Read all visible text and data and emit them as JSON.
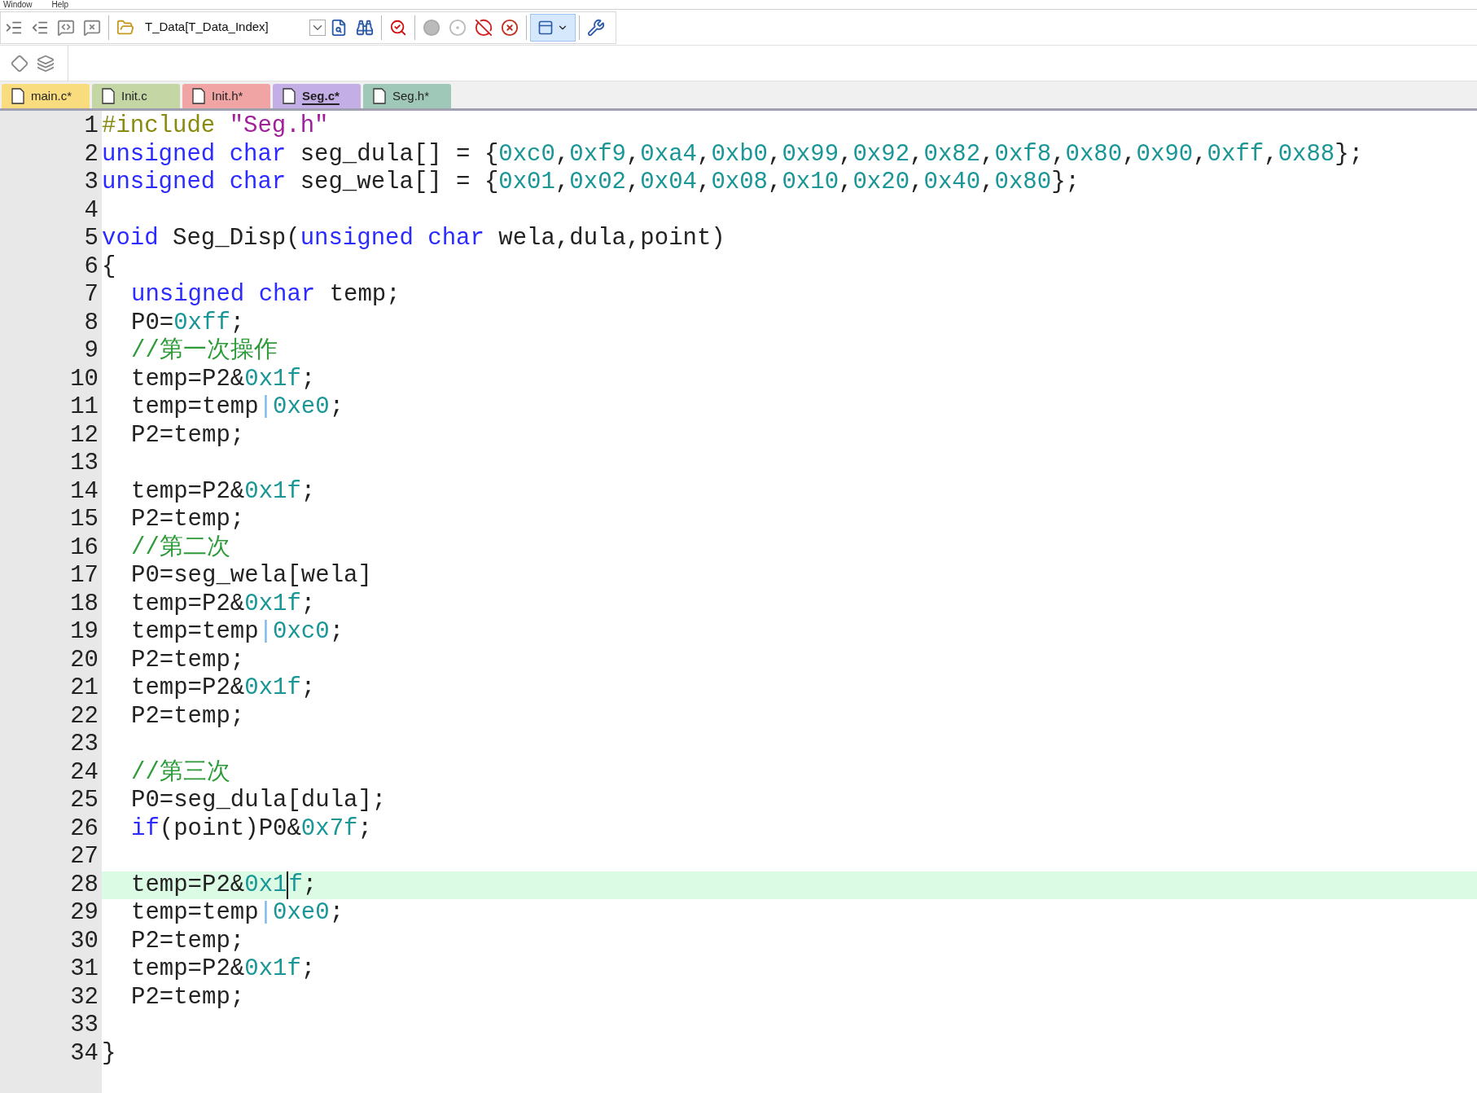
{
  "menu": [
    "Window",
    "Help"
  ],
  "toolbar": {
    "target": "T_Data[T_Data_Index]"
  },
  "tabs": [
    {
      "label": "main.c*",
      "color": "#f9dc7e",
      "selected": false
    },
    {
      "label": "Init.c",
      "color": "#c5d6a5",
      "selected": false
    },
    {
      "label": "Init.h*",
      "color": "#f0a4a4",
      "selected": false
    },
    {
      "label": "Seg.c*",
      "color": "#c4aee6",
      "selected": true
    },
    {
      "label": "Seg.h*",
      "color": "#a0c8b8",
      "selected": false
    }
  ],
  "lines": [
    {
      "number": "1",
      "indented": false,
      "current": false,
      "tokens": [
        {
          "kind": "pre",
          "text": "#include "
        },
        {
          "kind": "str",
          "text": "\"Seg.h\""
        }
      ]
    },
    {
      "number": "2",
      "indented": false,
      "current": false,
      "tokens": [
        {
          "kind": "kw",
          "text": "unsigned char"
        },
        {
          "kind": "pl",
          "text": " seg_dula[] = {"
        },
        {
          "kind": "num",
          "text": "0xc0"
        },
        {
          "kind": "pl",
          "text": ","
        },
        {
          "kind": "num",
          "text": "0xf9"
        },
        {
          "kind": "pl",
          "text": ","
        },
        {
          "kind": "num",
          "text": "0xa4"
        },
        {
          "kind": "pl",
          "text": ","
        },
        {
          "kind": "num",
          "text": "0xb0"
        },
        {
          "kind": "pl",
          "text": ","
        },
        {
          "kind": "num",
          "text": "0x99"
        },
        {
          "kind": "pl",
          "text": ","
        },
        {
          "kind": "num",
          "text": "0x92"
        },
        {
          "kind": "pl",
          "text": ","
        },
        {
          "kind": "num",
          "text": "0x82"
        },
        {
          "kind": "pl",
          "text": ","
        },
        {
          "kind": "num",
          "text": "0xf8"
        },
        {
          "kind": "pl",
          "text": ","
        },
        {
          "kind": "num",
          "text": "0x80"
        },
        {
          "kind": "pl",
          "text": ","
        },
        {
          "kind": "num",
          "text": "0x90"
        },
        {
          "kind": "pl",
          "text": ","
        },
        {
          "kind": "num",
          "text": "0xff"
        },
        {
          "kind": "pl",
          "text": ","
        },
        {
          "kind": "num",
          "text": "0x88"
        },
        {
          "kind": "pl",
          "text": "};"
        }
      ]
    },
    {
      "number": "3",
      "indented": false,
      "current": false,
      "tokens": [
        {
          "kind": "kw",
          "text": "unsigned char"
        },
        {
          "kind": "pl",
          "text": " seg_wela[] = {"
        },
        {
          "kind": "num",
          "text": "0x01"
        },
        {
          "kind": "pl",
          "text": ","
        },
        {
          "kind": "num",
          "text": "0x02"
        },
        {
          "kind": "pl",
          "text": ","
        },
        {
          "kind": "num",
          "text": "0x04"
        },
        {
          "kind": "pl",
          "text": ","
        },
        {
          "kind": "num",
          "text": "0x08"
        },
        {
          "kind": "pl",
          "text": ","
        },
        {
          "kind": "num",
          "text": "0x10"
        },
        {
          "kind": "pl",
          "text": ","
        },
        {
          "kind": "num",
          "text": "0x20"
        },
        {
          "kind": "pl",
          "text": ","
        },
        {
          "kind": "num",
          "text": "0x40"
        },
        {
          "kind": "pl",
          "text": ","
        },
        {
          "kind": "num",
          "text": "0x80"
        },
        {
          "kind": "pl",
          "text": "};"
        }
      ]
    },
    {
      "number": "4",
      "current": false
    },
    {
      "number": "5",
      "indented": false,
      "current": false,
      "tokens": [
        {
          "kind": "kw",
          "text": "void"
        },
        {
          "kind": "pl",
          "text": " Seg_Disp("
        },
        {
          "kind": "kw",
          "text": "unsigned char"
        },
        {
          "kind": "pl",
          "text": " wela,dula,point)"
        }
      ]
    },
    {
      "number": "6",
      "indented": false,
      "current": false,
      "tokens": [
        {
          "kind": "pl",
          "text": "{"
        }
      ]
    },
    {
      "number": "7",
      "indented": true,
      "current": false,
      "tokens": [
        {
          "kind": "kw",
          "text": "unsigned char"
        },
        {
          "kind": "pl",
          "text": " temp;"
        }
      ]
    },
    {
      "number": "8",
      "indented": true,
      "current": false,
      "tokens": [
        {
          "kind": "pl",
          "text": "P0="
        },
        {
          "kind": "num",
          "text": "0xff"
        },
        {
          "kind": "pl",
          "text": ";"
        }
      ]
    },
    {
      "number": "9",
      "indented": true,
      "current": false,
      "tokens": [
        {
          "kind": "com",
          "text": "//第一次操作"
        }
      ]
    },
    {
      "number": "10",
      "indented": true,
      "current": false,
      "tokens": [
        {
          "kind": "pl",
          "text": "temp=P2&"
        },
        {
          "kind": "num",
          "text": "0x1f"
        },
        {
          "kind": "pl",
          "text": ";"
        }
      ]
    },
    {
      "number": "11",
      "indented": true,
      "current": false,
      "tokens": [
        {
          "kind": "pl",
          "text": "temp=temp"
        },
        {
          "kind": "op",
          "text": "|"
        },
        {
          "kind": "num",
          "text": "0xe0"
        },
        {
          "kind": "pl",
          "text": ";"
        }
      ]
    },
    {
      "number": "12",
      "indented": true,
      "current": false,
      "tokens": [
        {
          "kind": "pl",
          "text": "P2=temp;"
        }
      ]
    },
    {
      "number": "13",
      "current": false
    },
    {
      "number": "14",
      "indented": true,
      "current": false,
      "tokens": [
        {
          "kind": "pl",
          "text": "temp=P2&"
        },
        {
          "kind": "num",
          "text": "0x1f"
        },
        {
          "kind": "pl",
          "text": ";"
        }
      ]
    },
    {
      "number": "15",
      "indented": true,
      "current": false,
      "tokens": [
        {
          "kind": "pl",
          "text": "P2=temp;"
        }
      ]
    },
    {
      "number": "16",
      "indented": true,
      "current": false,
      "tokens": [
        {
          "kind": "com",
          "text": "//第二次"
        }
      ]
    },
    {
      "number": "17",
      "indented": true,
      "current": false,
      "tokens": [
        {
          "kind": "pl",
          "text": "P0=seg_wela[wela]"
        }
      ]
    },
    {
      "number": "18",
      "indented": true,
      "current": false,
      "tokens": [
        {
          "kind": "pl",
          "text": "temp=P2&"
        },
        {
          "kind": "num",
          "text": "0x1f"
        },
        {
          "kind": "pl",
          "text": ";"
        }
      ]
    },
    {
      "number": "19",
      "indented": true,
      "current": false,
      "tokens": [
        {
          "kind": "pl",
          "text": "temp=temp"
        },
        {
          "kind": "op",
          "text": "|"
        },
        {
          "kind": "num",
          "text": "0xc0"
        },
        {
          "kind": "pl",
          "text": ";"
        }
      ]
    },
    {
      "number": "20",
      "indented": true,
      "current": false,
      "tokens": [
        {
          "kind": "pl",
          "text": "P2=temp;"
        }
      ]
    },
    {
      "number": "21",
      "indented": true,
      "current": false,
      "tokens": [
        {
          "kind": "pl",
          "text": "temp=P2&"
        },
        {
          "kind": "num",
          "text": "0x1f"
        },
        {
          "kind": "pl",
          "text": ";"
        }
      ]
    },
    {
      "number": "22",
      "indented": true,
      "current": false,
      "tokens": [
        {
          "kind": "pl",
          "text": "P2=temp;"
        }
      ]
    },
    {
      "number": "23",
      "current": false
    },
    {
      "number": "24",
      "indented": true,
      "current": false,
      "tokens": [
        {
          "kind": "com",
          "text": "//第三次"
        }
      ]
    },
    {
      "number": "25",
      "indented": true,
      "current": false,
      "tokens": [
        {
          "kind": "pl",
          "text": "P0=seg_dula[dula];"
        }
      ]
    },
    {
      "number": "26",
      "indented": true,
      "current": false,
      "tokens": [
        {
          "kind": "kw",
          "text": "if"
        },
        {
          "kind": "pl",
          "text": "(point)P0&"
        },
        {
          "kind": "num",
          "text": "0x7f"
        },
        {
          "kind": "pl",
          "text": ";"
        }
      ]
    },
    {
      "number": "27",
      "current": false
    },
    {
      "number": "28",
      "indented": true,
      "current": true,
      "tokens": [
        {
          "kind": "pl",
          "text": "temp=P2&"
        },
        {
          "kind": "num",
          "text": "0x1"
        },
        {
          "kind": "num",
          "text": "f",
          "caret": true
        },
        {
          "kind": "pl",
          "text": ";"
        }
      ]
    },
    {
      "number": "29",
      "indented": true,
      "current": false,
      "tokens": [
        {
          "kind": "pl",
          "text": "temp=temp"
        },
        {
          "kind": "op",
          "text": "|"
        },
        {
          "kind": "num",
          "text": "0xe0"
        },
        {
          "kind": "pl",
          "text": ";"
        }
      ]
    },
    {
      "number": "30",
      "indented": true,
      "current": false,
      "tokens": [
        {
          "kind": "pl",
          "text": "P2=temp;"
        }
      ]
    },
    {
      "number": "31",
      "indented": true,
      "current": false,
      "tokens": [
        {
          "kind": "pl",
          "text": "temp=P2&"
        },
        {
          "kind": "num",
          "text": "0x1f"
        },
        {
          "kind": "pl",
          "text": ";"
        }
      ]
    },
    {
      "number": "32",
      "indented": true,
      "current": false,
      "tokens": [
        {
          "kind": "pl",
          "text": "P2=temp;"
        }
      ]
    },
    {
      "number": "33",
      "current": false
    },
    {
      "number": "34",
      "indented": false,
      "current": false,
      "tokens": [
        {
          "kind": "pl",
          "text": "}"
        }
      ]
    }
  ]
}
